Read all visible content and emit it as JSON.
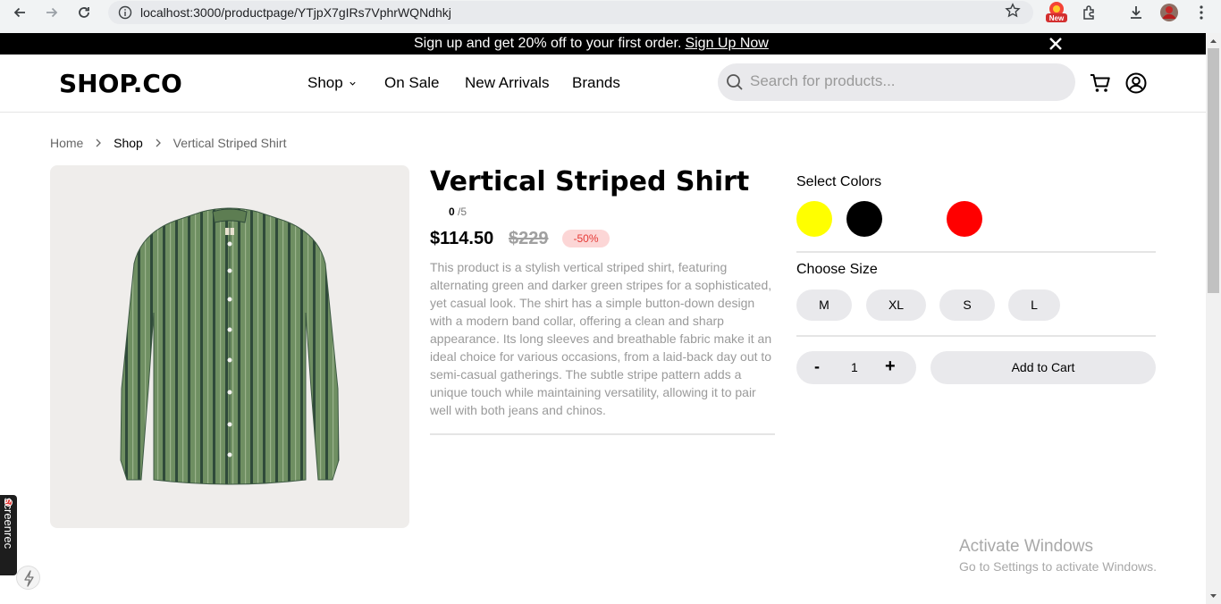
{
  "browser": {
    "url": "localhost:3000/productpage/YTjpX7gIRs7VphrWQNdhkj",
    "extension_badge": "New"
  },
  "promo": {
    "text": "Sign up and get 20% off to your first order.",
    "link": "Sign Up Now"
  },
  "header": {
    "logo": "SHOP.CO",
    "nav": [
      "Shop",
      "On Sale",
      "New Arrivals",
      "Brands"
    ],
    "search_placeholder": "Search for products..."
  },
  "breadcrumb": [
    "Home",
    "Shop",
    "Vertical Striped Shirt"
  ],
  "product": {
    "title": "Vertical Striped Shirt",
    "rating": "0",
    "rating_max": "/5",
    "price": "$114.50",
    "old_price": "$229",
    "discount": "-50%",
    "description": "This product is a stylish vertical striped shirt, featuring alternating green and darker green stripes for a sophisticated, yet casual look. The shirt has a simple button-down design with a modern band collar, offering a clean and sharp appearance. Its long sleeves and breathable fabric make it an ideal choice for various occasions, from a laid-back day out to semi-casual gatherings. The subtle stripe pattern adds a unique touch while maintaining versatility, allowing it to pair well with both jeans and chinos."
  },
  "options": {
    "colors_label": "Select Colors",
    "colors": [
      "#ffff00",
      "#000000",
      "#ffffff",
      "#ff0000"
    ],
    "size_label": "Choose Size",
    "sizes": [
      "M",
      "XL",
      "S",
      "L"
    ],
    "qty_minus": "-",
    "quantity": "1",
    "qty_plus": "+",
    "add_to_cart": "Add to Cart"
  },
  "overlays": {
    "activate_title": "Activate Windows",
    "activate_sub": "Go to Settings to activate Windows.",
    "screenrec": "screenrec"
  }
}
